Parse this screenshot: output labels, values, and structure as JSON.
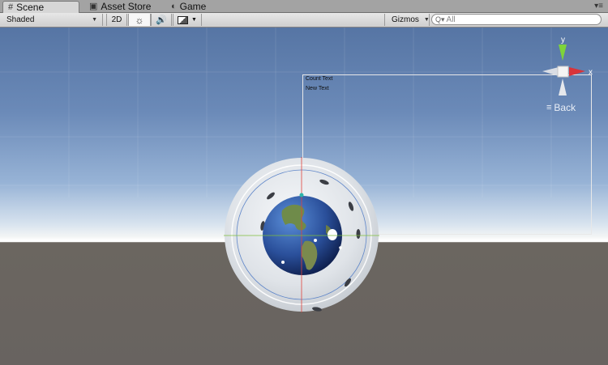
{
  "tabs": [
    {
      "label": "Scene",
      "icon": "grid-icon",
      "active": true
    },
    {
      "label": "Asset Store",
      "icon": "store-icon",
      "active": false
    },
    {
      "label": "Game",
      "icon": "game-icon",
      "active": false
    }
  ],
  "tab_menu_icon": "panel-menu-icon",
  "toolbar": {
    "shading_mode": "Shaded",
    "mode_2d": "2D",
    "lighting_icon": "sun-icon",
    "audio_icon": "speaker-icon",
    "effects_icon": "image-icon",
    "gizmos_label": "Gizmos",
    "search_placeholder": "All"
  },
  "scene": {
    "canvas_texts": [
      "Count Text",
      "New Text"
    ],
    "gizmo_axes": {
      "y": "y",
      "x": "x"
    },
    "view_label": "Back",
    "colors": {
      "sky_top": "#5675a4",
      "horizon": "#ffffff",
      "ground": "#686360",
      "y_axis": "#7ed43a",
      "x_axis": "#d8343a"
    }
  }
}
